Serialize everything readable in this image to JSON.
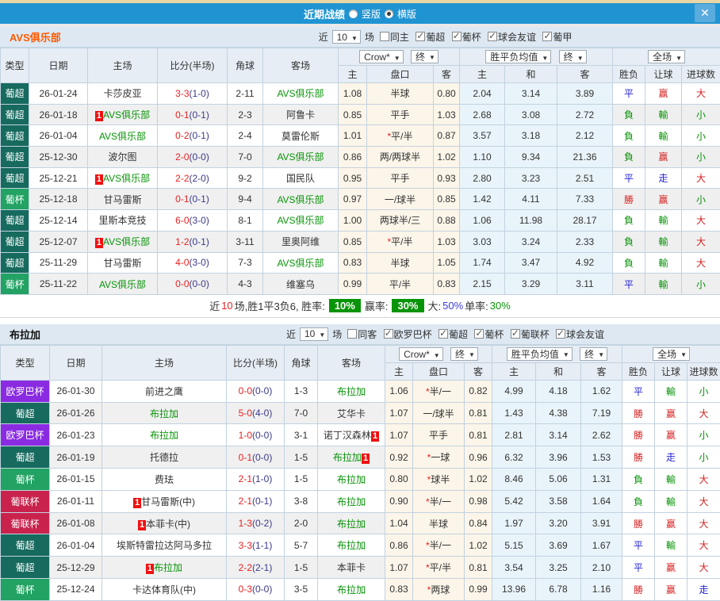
{
  "titlebar": {
    "title": "近期战绩",
    "close_icon": "✕",
    "radios": [
      {
        "label": "竖版",
        "checked": false
      },
      {
        "label": "横版",
        "checked": true
      }
    ]
  },
  "colors": {
    "titlebar_blue": "#2094d2",
    "top_strip_tan": "#e9d6a4",
    "league_pu_chao": "#166a5e",
    "league_pu_bei": "#22a263",
    "league_europa": "#8a2be2",
    "league_pu_lian_bei": "#c9234d",
    "win_red": "#d42222",
    "lose_green": "#089408",
    "draw_blue": "#2424d4",
    "team_green": "#089408",
    "score_red": "#e62222",
    "half_navy": "#3a3a8c",
    "highlight_green_bg": "#089408",
    "team1_orange": "#ff5a00"
  },
  "sections": [
    {
      "team": "AVS俱乐部",
      "near": "近",
      "games": "10",
      "games_unit": "场",
      "checks": [
        {
          "label": "同主",
          "checked": false
        },
        {
          "label": "葡超",
          "checked": true
        },
        {
          "label": "葡杯",
          "checked": true
        },
        {
          "label": "球会友谊",
          "checked": true
        },
        {
          "label": "葡甲",
          "checked": true
        }
      ],
      "head": {
        "type": "类型",
        "date": "日期",
        "home": "主场",
        "score": "比分(半场)",
        "corner": "角球",
        "away": "客场",
        "dd_odds": "Crow*",
        "dd_fin": "终",
        "dd_avg": "胜平负均值",
        "dd_fin2": "终",
        "dd_full": "全场",
        "sub": {
          "h": "主",
          "hcap": "盘口",
          "a": "客",
          "w": "主",
          "d": "和",
          "l": "客",
          "res": "胜负",
          "ah": "让球",
          "ou": "进球数"
        }
      },
      "rows": [
        {
          "lg": "葡超",
          "date": "26-01-24",
          "hb1": "",
          "home": "卡莎皮亚",
          "hg": "",
          "hb2": "",
          "ft": "3-3",
          "ht": "(1-0)",
          "cor": "2-11",
          "ab1": "",
          "away": "AVS俱乐部",
          "ag": "g",
          "ab2": "",
          "o1": "1.08",
          "star": "",
          "hcap": "半球",
          "o2": "0.80",
          "w": "2.04",
          "d": "3.14",
          "l": "3.89",
          "r1": "平",
          "c1": "d",
          "r2": "赢",
          "c2": "w",
          "r3": "大",
          "c3": "w",
          "shade": false
        },
        {
          "lg": "葡超",
          "date": "26-01-18",
          "hb1": "1",
          "home": "AVS俱乐部",
          "hg": "g",
          "hb2": "",
          "ft": "0-1",
          "ht": "(0-1)",
          "cor": "2-3",
          "ab1": "",
          "away": "阿鲁卡",
          "ag": "",
          "ab2": "",
          "o1": "0.85",
          "star": "",
          "hcap": "平手",
          "o2": "1.03",
          "w": "2.68",
          "d": "3.08",
          "l": "2.72",
          "r1": "負",
          "c1": "l",
          "r2": "輸",
          "c2": "l",
          "r3": "小",
          "c3": "l",
          "shade": true
        },
        {
          "lg": "葡超",
          "date": "26-01-04",
          "hb1": "",
          "home": "AVS俱乐部",
          "hg": "g",
          "hb2": "",
          "ft": "0-2",
          "ht": "(0-1)",
          "cor": "2-4",
          "ab1": "",
          "away": "莫雷伦斯",
          "ag": "",
          "ab2": "",
          "o1": "1.01",
          "star": "*",
          "hcap": "平/半",
          "o2": "0.87",
          "w": "3.57",
          "d": "3.18",
          "l": "2.12",
          "r1": "負",
          "c1": "l",
          "r2": "輸",
          "c2": "l",
          "r3": "小",
          "c3": "l",
          "shade": false
        },
        {
          "lg": "葡超",
          "date": "25-12-30",
          "hb1": "",
          "home": "波尔图",
          "hg": "",
          "hb2": "",
          "ft": "2-0",
          "ht": "(0-0)",
          "cor": "7-0",
          "ab1": "",
          "away": "AVS俱乐部",
          "ag": "g",
          "ab2": "",
          "o1": "0.86",
          "star": "",
          "hcap": "两/两球半",
          "o2": "1.02",
          "w": "1.10",
          "d": "9.34",
          "l": "21.36",
          "r1": "負",
          "c1": "l",
          "r2": "赢",
          "c2": "w",
          "r3": "小",
          "c3": "l",
          "shade": true
        },
        {
          "lg": "葡超",
          "date": "25-12-21",
          "hb1": "1",
          "home": "AVS俱乐部",
          "hg": "g",
          "hb2": "",
          "ft": "2-2",
          "ht": "(2-0)",
          "cor": "9-2",
          "ab1": "",
          "away": "国民队",
          "ag": "",
          "ab2": "",
          "o1": "0.95",
          "star": "",
          "hcap": "平手",
          "o2": "0.93",
          "w": "2.80",
          "d": "3.23",
          "l": "2.51",
          "r1": "平",
          "c1": "d",
          "r2": "走",
          "c2": "d",
          "r3": "大",
          "c3": "w",
          "shade": false
        },
        {
          "lg": "葡杯",
          "date": "25-12-18",
          "hb1": "",
          "home": "甘马雷斯",
          "hg": "",
          "hb2": "",
          "ft": "0-1",
          "ht": "(0-1)",
          "cor": "9-4",
          "ab1": "",
          "away": "AVS俱乐部",
          "ag": "g",
          "ab2": "",
          "o1": "0.97",
          "star": "",
          "hcap": "一/球半",
          "o2": "0.85",
          "w": "1.42",
          "d": "4.11",
          "l": "7.33",
          "r1": "勝",
          "c1": "w",
          "r2": "赢",
          "c2": "w",
          "r3": "小",
          "c3": "l",
          "shade": true
        },
        {
          "lg": "葡超",
          "date": "25-12-14",
          "hb1": "",
          "home": "里斯本竞技",
          "hg": "",
          "hb2": "",
          "ft": "6-0",
          "ht": "(3-0)",
          "cor": "8-1",
          "ab1": "",
          "away": "AVS俱乐部",
          "ag": "g",
          "ab2": "",
          "o1": "1.00",
          "star": "",
          "hcap": "两球半/三",
          "o2": "0.88",
          "w": "1.06",
          "d": "11.98",
          "l": "28.17",
          "r1": "負",
          "c1": "l",
          "r2": "輸",
          "c2": "l",
          "r3": "大",
          "c3": "w",
          "shade": false
        },
        {
          "lg": "葡超",
          "date": "25-12-07",
          "hb1": "1",
          "home": "AVS俱乐部",
          "hg": "g",
          "hb2": "",
          "ft": "1-2",
          "ht": "(0-1)",
          "cor": "3-11",
          "ab1": "",
          "away": "里奥阿维",
          "ag": "",
          "ab2": "",
          "o1": "0.85",
          "star": "*",
          "hcap": "平/半",
          "o2": "1.03",
          "w": "3.03",
          "d": "3.24",
          "l": "2.33",
          "r1": "負",
          "c1": "l",
          "r2": "輸",
          "c2": "l",
          "r3": "大",
          "c3": "w",
          "shade": true
        },
        {
          "lg": "葡超",
          "date": "25-11-29",
          "hb1": "",
          "home": "甘马雷斯",
          "hg": "",
          "hb2": "",
          "ft": "4-0",
          "ht": "(3-0)",
          "cor": "7-3",
          "ab1": "",
          "away": "AVS俱乐部",
          "ag": "g",
          "ab2": "",
          "o1": "0.83",
          "star": "",
          "hcap": "半球",
          "o2": "1.05",
          "w": "1.74",
          "d": "3.47",
          "l": "4.92",
          "r1": "負",
          "c1": "l",
          "r2": "輸",
          "c2": "l",
          "r3": "大",
          "c3": "w",
          "shade": false
        },
        {
          "lg": "葡杯",
          "date": "25-11-22",
          "hb1": "",
          "home": "AVS俱乐部",
          "hg": "g",
          "hb2": "",
          "ft": "0-0",
          "ht": "(0-0)",
          "cor": "4-3",
          "ab1": "",
          "away": "维塞乌",
          "ag": "",
          "ab2": "",
          "o1": "0.99",
          "star": "",
          "hcap": "平/半",
          "o2": "0.83",
          "w": "2.15",
          "d": "3.29",
          "l": "3.11",
          "r1": "平",
          "c1": "d",
          "r2": "輸",
          "c2": "l",
          "r3": "小",
          "c3": "l",
          "shade": true
        }
      ],
      "summary_segments": [
        {
          "t": "近",
          "s": "plain"
        },
        {
          "t": "10",
          "s": "red"
        },
        {
          "t": "场,胜1平3负6, 胜率:",
          "s": "plain"
        },
        {
          "t": "10%",
          "s": "hl"
        },
        {
          "t": "赢率:",
          "s": "plain"
        },
        {
          "t": "30%",
          "s": "hl"
        },
        {
          "t": "大:",
          "s": "plain"
        },
        {
          "t": "50%",
          "s": "blue"
        },
        {
          "t": "单率:",
          "s": "plain"
        },
        {
          "t": "30%",
          "s": "green"
        }
      ]
    },
    {
      "team": "布拉加",
      "near": "近",
      "games": "10",
      "games_unit": "场",
      "checks": [
        {
          "label": "同客",
          "checked": false
        },
        {
          "label": "欧罗巴杯",
          "checked": true
        },
        {
          "label": "葡超",
          "checked": true
        },
        {
          "label": "葡杯",
          "checked": true
        },
        {
          "label": "葡联杯",
          "checked": true
        },
        {
          "label": "球会友谊",
          "checked": true
        }
      ],
      "head": {
        "type": "类型",
        "date": "日期",
        "home": "主场",
        "score": "比分(半场)",
        "corner": "角球",
        "away": "客场",
        "dd_odds": "Crow*",
        "dd_fin": "终",
        "dd_avg": "胜平负均值",
        "dd_fin2": "终",
        "dd_full": "全场",
        "sub": {
          "h": "主",
          "hcap": "盘口",
          "a": "客",
          "w": "主",
          "d": "和",
          "l": "客",
          "res": "胜负",
          "ah": "让球",
          "ou": "进球数"
        }
      },
      "rows": [
        {
          "lg": "欧罗巴杯",
          "date": "26-01-30",
          "hb1": "",
          "home": "前进之鹰",
          "hg": "",
          "hb2": "",
          "ft": "0-0",
          "ht": "(0-0)",
          "cor": "1-3",
          "ab1": "",
          "away": "布拉加",
          "ag": "g",
          "ab2": "",
          "o1": "1.06",
          "star": "*",
          "hcap": "半/一",
          "o2": "0.82",
          "w": "4.99",
          "d": "4.18",
          "l": "1.62",
          "r1": "平",
          "c1": "d",
          "r2": "輸",
          "c2": "l",
          "r3": "小",
          "c3": "l",
          "shade": false
        },
        {
          "lg": "葡超",
          "date": "26-01-26",
          "hb1": "",
          "home": "布拉加",
          "hg": "g",
          "hb2": "",
          "ft": "5-0",
          "ht": "(4-0)",
          "cor": "7-0",
          "ab1": "",
          "away": "艾华卡",
          "ag": "",
          "ab2": "",
          "o1": "1.07",
          "star": "",
          "hcap": "一/球半",
          "o2": "0.81",
          "w": "1.43",
          "d": "4.38",
          "l": "7.19",
          "r1": "勝",
          "c1": "w",
          "r2": "赢",
          "c2": "w",
          "r3": "大",
          "c3": "w",
          "shade": true
        },
        {
          "lg": "欧罗巴杯",
          "date": "26-01-23",
          "hb1": "",
          "home": "布拉加",
          "hg": "g",
          "hb2": "",
          "ft": "1-0",
          "ht": "(0-0)",
          "cor": "3-1",
          "ab1": "",
          "away": "诺丁汉森林",
          "ag": "",
          "ab2": "1",
          "o1": "1.07",
          "star": "",
          "hcap": "平手",
          "o2": "0.81",
          "w": "2.81",
          "d": "3.14",
          "l": "2.62",
          "r1": "勝",
          "c1": "w",
          "r2": "赢",
          "c2": "w",
          "r3": "小",
          "c3": "l",
          "shade": false
        },
        {
          "lg": "葡超",
          "date": "26-01-19",
          "hb1": "",
          "home": "托德拉",
          "hg": "",
          "hb2": "",
          "ft": "0-1",
          "ht": "(0-0)",
          "cor": "1-5",
          "ab1": "",
          "away": "布拉加",
          "ag": "g",
          "ab2": "1",
          "o1": "0.92",
          "star": "*",
          "hcap": "一球",
          "o2": "0.96",
          "w": "6.32",
          "d": "3.96",
          "l": "1.53",
          "r1": "勝",
          "c1": "w",
          "r2": "走",
          "c2": "d",
          "r3": "小",
          "c3": "l",
          "shade": true
        },
        {
          "lg": "葡杯",
          "date": "26-01-15",
          "hb1": "",
          "home": "费珐",
          "hg": "",
          "hb2": "",
          "ft": "2-1",
          "ht": "(1-0)",
          "cor": "1-5",
          "ab1": "",
          "away": "布拉加",
          "ag": "g",
          "ab2": "",
          "o1": "0.80",
          "star": "*",
          "hcap": "球半",
          "o2": "1.02",
          "w": "8.46",
          "d": "5.06",
          "l": "1.31",
          "r1": "負",
          "c1": "l",
          "r2": "輸",
          "c2": "l",
          "r3": "大",
          "c3": "w",
          "shade": false
        },
        {
          "lg": "葡联杯",
          "date": "26-01-11",
          "hb1": "1",
          "home": "甘马雷斯(中)",
          "hg": "",
          "hb2": "",
          "ft": "2-1",
          "ht": "(0-1)",
          "cor": "3-8",
          "ab1": "",
          "away": "布拉加",
          "ag": "g",
          "ab2": "",
          "o1": "0.90",
          "star": "*",
          "hcap": "半/一",
          "o2": "0.98",
          "w": "5.42",
          "d": "3.58",
          "l": "1.64",
          "r1": "負",
          "c1": "l",
          "r2": "輸",
          "c2": "l",
          "r3": "大",
          "c3": "w",
          "shade": false
        },
        {
          "lg": "葡联杯",
          "date": "26-01-08",
          "hb1": "1",
          "home": "本菲卡(中)",
          "hg": "",
          "hb2": "",
          "ft": "1-3",
          "ht": "(0-2)",
          "cor": "2-0",
          "ab1": "",
          "away": "布拉加",
          "ag": "g",
          "ab2": "",
          "o1": "1.04",
          "star": "",
          "hcap": "半球",
          "o2": "0.84",
          "w": "1.97",
          "d": "3.20",
          "l": "3.91",
          "r1": "勝",
          "c1": "w",
          "r2": "赢",
          "c2": "w",
          "r3": "大",
          "c3": "w",
          "shade": true
        },
        {
          "lg": "葡超",
          "date": "26-01-04",
          "hb1": "",
          "home": "埃斯特雷拉达阿马多拉",
          "hg": "",
          "hb2": "",
          "ft": "3-3",
          "ht": "(1-1)",
          "cor": "5-7",
          "ab1": "",
          "away": "布拉加",
          "ag": "g",
          "ab2": "",
          "o1": "0.86",
          "star": "*",
          "hcap": "半/一",
          "o2": "1.02",
          "w": "5.15",
          "d": "3.69",
          "l": "1.67",
          "r1": "平",
          "c1": "d",
          "r2": "輸",
          "c2": "l",
          "r3": "大",
          "c3": "w",
          "shade": false
        },
        {
          "lg": "葡超",
          "date": "25-12-29",
          "hb1": "1",
          "home": "布拉加",
          "hg": "g",
          "hb2": "",
          "ft": "2-2",
          "ht": "(2-1)",
          "cor": "1-5",
          "ab1": "",
          "away": "本菲卡",
          "ag": "",
          "ab2": "",
          "o1": "1.07",
          "star": "*",
          "hcap": "平/半",
          "o2": "0.81",
          "w": "3.54",
          "d": "3.25",
          "l": "2.10",
          "r1": "平",
          "c1": "d",
          "r2": "赢",
          "c2": "w",
          "r3": "大",
          "c3": "w",
          "shade": true
        },
        {
          "lg": "葡杯",
          "date": "25-12-24",
          "hb1": "",
          "home": "卡达体育队(中)",
          "hg": "",
          "hb2": "",
          "ft": "0-3",
          "ht": "(0-0)",
          "cor": "3-5",
          "ab1": "",
          "away": "布拉加",
          "ag": "g",
          "ab2": "",
          "o1": "0.83",
          "star": "*",
          "hcap": "两球",
          "o2": "0.99",
          "w": "13.96",
          "d": "6.78",
          "l": "1.16",
          "r1": "勝",
          "c1": "w",
          "r2": "赢",
          "c2": "w",
          "r3": "走",
          "c3": "d",
          "shade": false
        }
      ],
      "summary_segments": []
    }
  ]
}
